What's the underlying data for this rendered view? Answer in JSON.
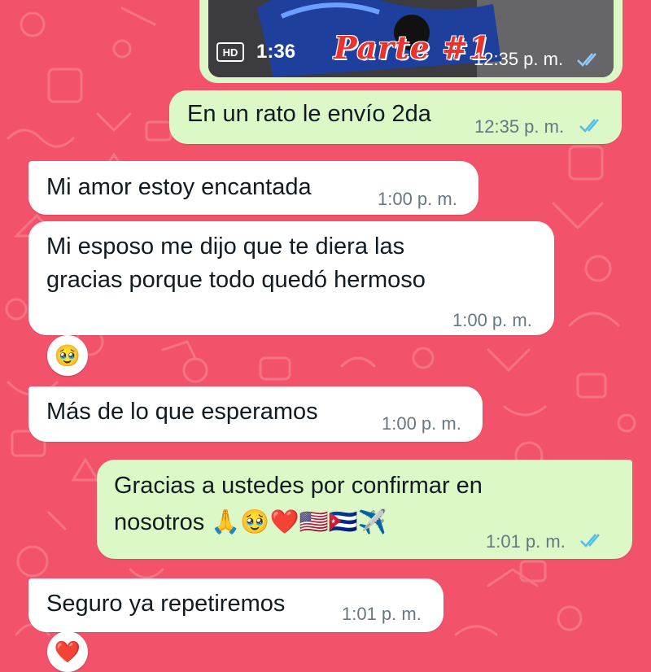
{
  "messages": {
    "video": {
      "badge": "HD",
      "duration": "1:36",
      "overlay_text": "Parte #1",
      "time": "12:35 p. m."
    },
    "m1": {
      "text": "En un rato le envío 2da",
      "time": "12:35 p. m."
    },
    "m2": {
      "text": "Mi amor estoy encantada",
      "time": "1:00 p. m."
    },
    "m3": {
      "line1": "Mi esposo me dijo que te diera las",
      "line2": "gracias porque todo quedó hermoso",
      "time": "1:00 p. m.",
      "reaction": "🥹"
    },
    "m4": {
      "text": "Más de lo que esperamos",
      "time": "1:00 p. m."
    },
    "m5": {
      "line1": "Gracias  a ustedes por confirmar en",
      "line2": "nosotros 🙏🥹❤️🇺🇸🇨🇺✈️",
      "time": "1:01 p. m."
    },
    "m6": {
      "text": "Seguro ya repetiremos",
      "time": "1:01 p. m.",
      "reaction": "❤️"
    }
  },
  "colors": {
    "background": "#f2536a",
    "incoming_bubble": "#ffffff",
    "outgoing_bubble": "#dcf8c6",
    "read_ticks": "#53bdeb"
  }
}
